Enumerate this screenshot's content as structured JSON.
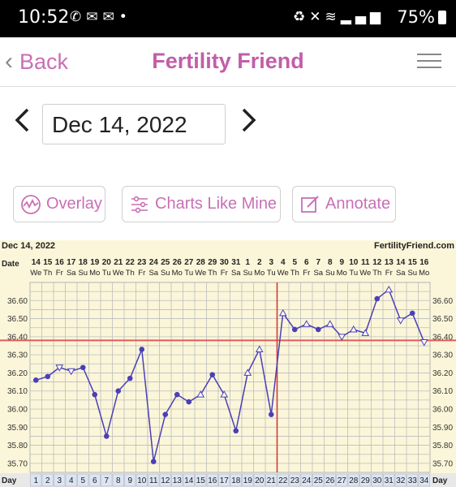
{
  "status_bar": {
    "time": "10:52",
    "left_icons": [
      "whatsapp-icon",
      "mail-icon",
      "mail-icon",
      "dot-icon"
    ],
    "right_icons": [
      "recycle-icon",
      "mute-icon",
      "wifi-call-icon",
      "volte-icon",
      "signal-icon"
    ],
    "battery": "75%"
  },
  "header": {
    "back_label": "Back",
    "title": "Fertility Friend",
    "title_color": "#c25ea8",
    "accent": "#c96fb4"
  },
  "date_nav": {
    "date": "Dec 14, 2022"
  },
  "actions": {
    "overlay": "Overlay",
    "charts_like_mine": "Charts Like Mine",
    "annotate": "Annotate"
  },
  "chart_data": {
    "type": "line",
    "header_date": "Dec 14, 2022",
    "brand": "FertilityFriend.com",
    "date_row_label": "Date",
    "day_row_label": "Day",
    "dates": [
      "14",
      "15",
      "16",
      "17",
      "18",
      "19",
      "20",
      "21",
      "22",
      "23",
      "24",
      "25",
      "26",
      "27",
      "28",
      "29",
      "30",
      "31",
      "1",
      "2",
      "3",
      "4",
      "5",
      "6",
      "7",
      "8",
      "9",
      "10",
      "11",
      "12",
      "13",
      "14",
      "15",
      "16"
    ],
    "weekdays": [
      "We",
      "Th",
      "Fr",
      "Sa",
      "Su",
      "Mo",
      "Tu",
      "We",
      "Th",
      "Fr",
      "Sa",
      "Su",
      "Mo",
      "Tu",
      "We",
      "Th",
      "Fr",
      "Sa",
      "Su",
      "Mo",
      "Tu",
      "We",
      "Th",
      "Fr",
      "Sa",
      "Su",
      "Mo",
      "Tu",
      "We",
      "Th",
      "Fr",
      "Sa",
      "Su",
      "Mo"
    ],
    "days": [
      1,
      2,
      3,
      4,
      5,
      6,
      7,
      8,
      9,
      10,
      11,
      12,
      13,
      14,
      15,
      16,
      17,
      18,
      19,
      20,
      21,
      22,
      23,
      24,
      25,
      26,
      27,
      28,
      29,
      30,
      31,
      32,
      33,
      34
    ],
    "y_ticks": [
      "35.70",
      "35.80",
      "35.90",
      "36.00",
      "36.10",
      "36.20",
      "36.30",
      "36.40",
      "36.50",
      "36.60"
    ],
    "ylim": [
      35.65,
      36.7
    ],
    "temps": [
      36.16,
      36.18,
      36.23,
      36.21,
      36.23,
      36.08,
      35.85,
      36.1,
      36.17,
      36.33,
      35.71,
      35.97,
      36.08,
      36.04,
      36.08,
      36.19,
      36.08,
      35.88,
      36.2,
      36.33,
      35.97,
      36.53,
      36.44,
      36.47,
      36.44,
      36.47,
      36.4,
      36.44,
      36.42,
      36.61,
      36.66,
      36.49,
      36.53,
      36.37
    ],
    "markers": [
      "dot",
      "dot",
      "open-down",
      "open-down",
      "dot",
      "dot",
      "dot",
      "dot",
      "dot",
      "dot",
      "dot",
      "dot",
      "dot",
      "dot",
      "open-up",
      "dot",
      "open-up",
      "dot",
      "open-up",
      "open-up",
      "dot",
      "open-up",
      "dot",
      "open-up",
      "dot",
      "open-up",
      "open-down",
      "open-up",
      "open-up",
      "dot",
      "open-up",
      "open-down",
      "dot",
      "open-down"
    ],
    "coverline": 36.38,
    "ovulation_day": 21,
    "colors": {
      "line": "#4b3fb8",
      "coverline": "#e05a5a",
      "ovulation": "#d23b3b",
      "background": "#fbf6d9",
      "grid": "#bdbdbd"
    }
  }
}
